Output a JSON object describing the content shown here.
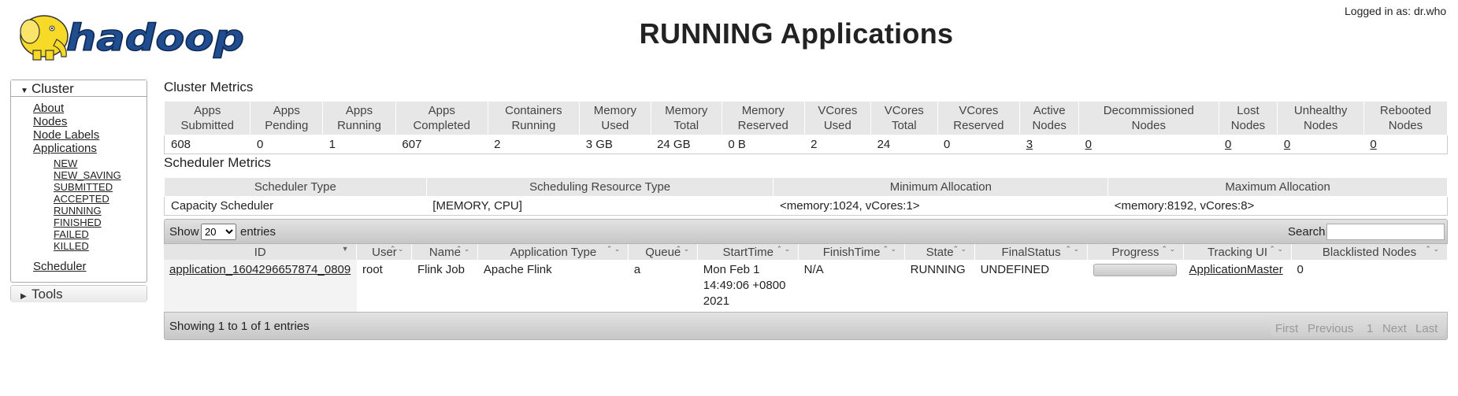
{
  "header": {
    "title": "RUNNING Applications",
    "logged_in": "Logged in as: dr.who",
    "logo_text": "hadoop"
  },
  "sidebar": {
    "cluster_label": "Cluster",
    "links": [
      "About",
      "Nodes",
      "Node Labels",
      "Applications"
    ],
    "app_states": [
      "NEW",
      "NEW_SAVING",
      "SUBMITTED",
      "ACCEPTED",
      "RUNNING",
      "FINISHED",
      "FAILED",
      "KILLED"
    ],
    "scheduler": "Scheduler",
    "tools_label": "Tools"
  },
  "cluster_metrics": {
    "title": "Cluster Metrics",
    "headers": [
      [
        "Apps",
        "Submitted"
      ],
      [
        "Apps",
        "Pending"
      ],
      [
        "Apps",
        "Running"
      ],
      [
        "Apps",
        "Completed"
      ],
      [
        "Containers",
        "Running"
      ],
      [
        "Memory",
        "Used"
      ],
      [
        "Memory",
        "Total"
      ],
      [
        "Memory",
        "Reserved"
      ],
      [
        "VCores",
        "Used"
      ],
      [
        "VCores",
        "Total"
      ],
      [
        "VCores",
        "Reserved"
      ],
      [
        "Active",
        "Nodes"
      ],
      [
        "Decommissioned",
        "Nodes"
      ],
      [
        "Lost",
        "Nodes"
      ],
      [
        "Unhealthy",
        "Nodes"
      ],
      [
        "Rebooted",
        "Nodes"
      ]
    ],
    "values": [
      "608",
      "0",
      "1",
      "607",
      "2",
      "3 GB",
      "24 GB",
      "0 B",
      "2",
      "24",
      "0",
      "3",
      "0",
      "0",
      "0",
      "0"
    ],
    "linked_from_index": 11
  },
  "scheduler_metrics": {
    "title": "Scheduler Metrics",
    "headers": [
      "Scheduler Type",
      "Scheduling Resource Type",
      "Minimum Allocation",
      "Maximum Allocation"
    ],
    "values": [
      "Capacity Scheduler",
      "[MEMORY, CPU]",
      "<memory:1024, vCores:1>",
      "<memory:8192, vCores:8>"
    ]
  },
  "apps_table": {
    "show_label": "Show",
    "page_length": "20",
    "entries_label": "entries",
    "search_label": "Search:",
    "search_value": "",
    "columns": [
      "ID",
      "User",
      "Name",
      "Application Type",
      "Queue",
      "StartTime",
      "FinishTime",
      "State",
      "FinalStatus",
      "Progress",
      "Tracking UI",
      "Blacklisted Nodes"
    ],
    "rows": [
      {
        "id": "application_1604296657874_0809",
        "user": "root",
        "name": "Flink Job",
        "type": "Apache Flink",
        "queue": "a",
        "start_time": "Mon Feb 1 14:49:06 +0800 2021",
        "finish_time": "N/A",
        "state": "RUNNING",
        "final_status": "UNDEFINED",
        "progress_pct": 0,
        "tracking_ui": "ApplicationMaster",
        "blacklisted_nodes": "0"
      }
    ],
    "info": "Showing 1 to 1 of 1 entries",
    "pager": {
      "first": "First",
      "previous": "Previous",
      "page": "1",
      "next": "Next",
      "last": "Last"
    }
  },
  "colors": {
    "logo_yellow": "#f7d928",
    "logo_blue": "#1f4d8f",
    "header_gray": "#e5e5e5"
  }
}
